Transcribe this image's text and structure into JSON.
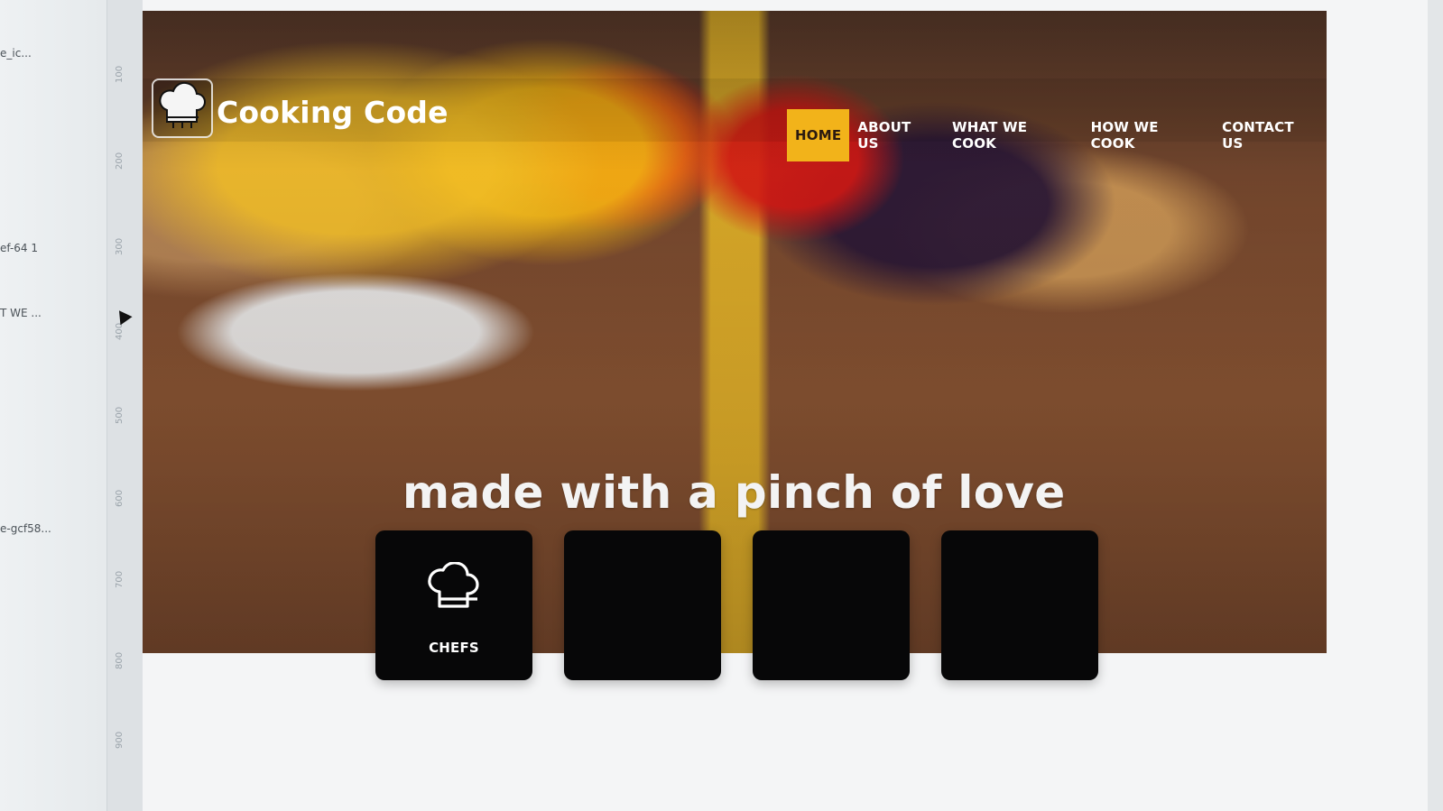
{
  "editor": {
    "side_labels": [
      "e_ic...",
      "ef-64 1",
      "T WE ...",
      "e-gcf58..."
    ],
    "ruler_ticks": [
      "100",
      "200",
      "300",
      "400",
      "500",
      "600",
      "700",
      "800",
      "900"
    ]
  },
  "website": {
    "brand": "Cooking Code",
    "nav": [
      "HOME",
      "ABOUT US",
      "WHAT WE COOK",
      "HOW WE COOK",
      "CONTACT US"
    ],
    "active_nav": "HOME",
    "tagline": "made with a pinch of love",
    "cards": [
      {
        "icon": "chef-hat-icon",
        "label": "CHEFS"
      },
      {
        "icon": "",
        "label": ""
      },
      {
        "icon": "",
        "label": ""
      },
      {
        "icon": "",
        "label": ""
      }
    ],
    "colors": {
      "accent": "#f2b31a",
      "card_bg": "#070708",
      "nav_text": "#ffffff"
    }
  }
}
